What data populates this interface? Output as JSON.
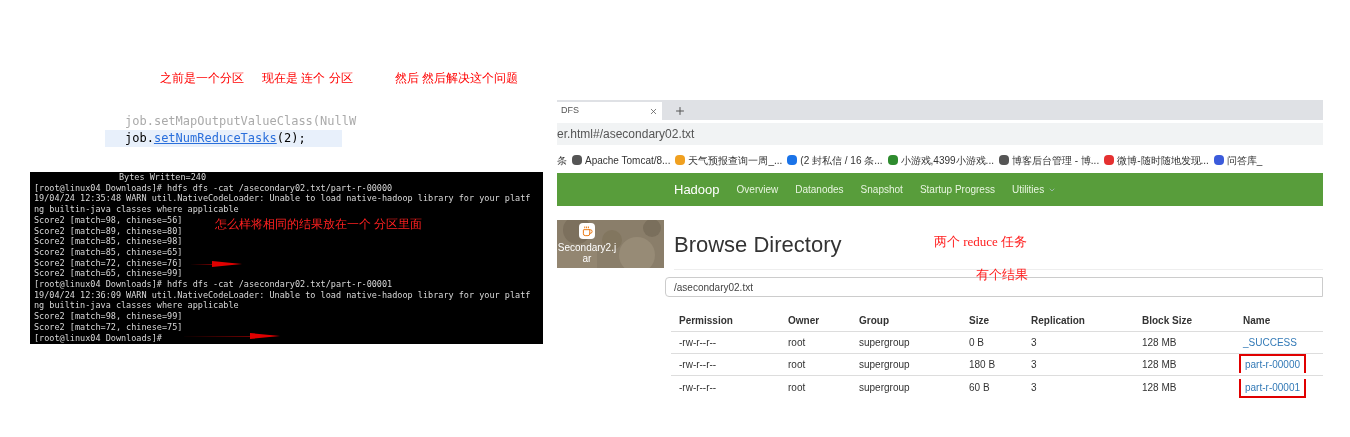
{
  "notes_top": [
    "之前是一个分区",
    "现在是 连个 分区",
    "然后 然后解决这个问题"
  ],
  "code": {
    "lines": [
      {
        "obj": "job.",
        "method": "setMapOutputValueClass",
        "args": "(NullW",
        "kind": "plain"
      },
      {
        "obj": "job.",
        "method": "setNumReduceTasks",
        "args": "(2);",
        "kind": "link"
      }
    ]
  },
  "terminal": {
    "lines": [
      "Bytes Written=240",
      "[root@linux04 Downloads]# hdfs dfs -cat /asecondary02.txt/part-r-00000",
      "19/04/24 12:35:48 WARN util.NativeCodeLoader: Unable to load native-hadoop library for your platf",
      "ng builtin-java classes where applicable",
      "Score2 [match=98, chinese=56]",
      "Score2 [match=89, chinese=80]",
      "Score2 [match=85, chinese=98]",
      "Score2 [match=85, chinese=65]",
      "Score2 [match=72, chinese=76]",
      "Score2 [match=65, chinese=99]",
      "[root@linux04 Downloads]# hdfs dfs -cat /asecondary02.txt/part-r-00001",
      "19/04/24 12:36:09 WARN util.NativeCodeLoader: Unable to load native-hadoop library for your platf",
      "ng builtin-java classes where applicable",
      "Score2 [match=98, chinese=99]",
      "Score2 [match=72, chinese=75]",
      "[root@linux04 Downloads]# "
    ],
    "note": "怎么样将相同的结果放在一个  分区里面"
  },
  "browser": {
    "tab": "DFS",
    "address": "er.html#/asecondary02.txt",
    "bookmarks": [
      "条",
      "Apache Tomcat/8...",
      "天气预报查询一周_...",
      "(2 封私信 / 16 条...",
      "小游戏,4399小游戏...",
      "博客后台管理 - 博...",
      "微博-随时随地发现...",
      "问答库_"
    ],
    "nav": {
      "brand": "Hadoop",
      "items": [
        "Overview",
        "Datanodes",
        "Snapshot",
        "Startup Progress",
        "Utilities"
      ]
    },
    "desktop_file": "Secondary2.jar",
    "heading": "Browse Directory",
    "notes": [
      "两个 reduce 任务",
      "有个结果"
    ],
    "path": "/asecondary02.txt",
    "table": {
      "columns": [
        "Permission",
        "Owner",
        "Group",
        "Size",
        "Replication",
        "Block Size",
        "Name"
      ],
      "rows": [
        {
          "cells": [
            "-rw-r--r--",
            "root",
            "supergroup",
            "0 B",
            "3",
            "128 MB",
            "_SUCCESS"
          ],
          "boxed": false
        },
        {
          "cells": [
            "-rw-r--r--",
            "root",
            "supergroup",
            "180 B",
            "3",
            "128 MB",
            "part-r-00000"
          ],
          "boxed": true
        },
        {
          "cells": [
            "-rw-r--r--",
            "root",
            "supergroup",
            "60 B",
            "3",
            "128 MB",
            "part-r-00001"
          ],
          "boxed": true
        }
      ]
    }
  }
}
